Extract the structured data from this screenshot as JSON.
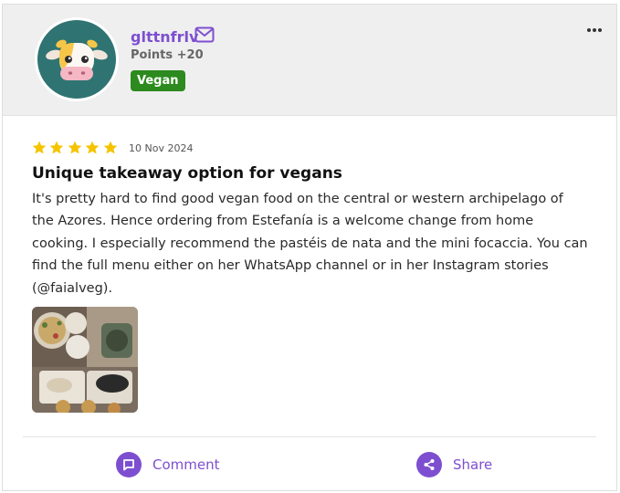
{
  "user": {
    "name": "glttnfrlv",
    "points": "Points +20",
    "badge": "Vegan",
    "avatar": "cow-avatar-icon"
  },
  "review": {
    "rating": 5,
    "max_rating": 5,
    "date": "10 Nov 2024",
    "title": "Unique takeaway option for vegans",
    "body": "It's pretty hard to find good vegan food on the central or western archipelago of the Azores. Hence ordering from Estefanía is a welcome change from home cooking. I especially recommend the pastéis de nata and the mini focaccia. You can find the full menu either on her WhatsApp channel or in her Instagram stories (@faialveg).",
    "photo_count": 1
  },
  "actions": {
    "comment_label": "Comment",
    "share_label": "Share"
  },
  "colors": {
    "accent": "#7d4fd0",
    "badge": "#2c8a1e",
    "star": "#f5c400",
    "header_bg": "#efefef",
    "avatar_bg": "#2f7472"
  },
  "icons": {
    "mail": "mail-icon",
    "more": "more-icon",
    "comment": "comment-icon",
    "share": "share-icon",
    "star": "star-icon"
  }
}
